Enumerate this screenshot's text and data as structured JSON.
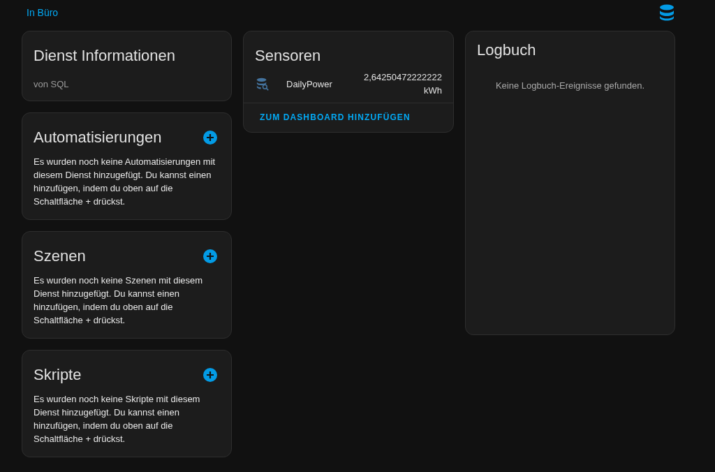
{
  "header": {
    "area_link": "In Büro"
  },
  "info_card": {
    "title": "Dienst Informationen",
    "subtitle": "von SQL"
  },
  "related_cards": [
    {
      "title": "Automatisierungen",
      "text": "Es wurden noch keine Automatisierungen mit diesem Dienst hinzugefügt. Du kannst einen hinzufügen, indem du oben auf die Schaltfläche + drückst."
    },
    {
      "title": "Szenen",
      "text": "Es wurden noch keine Szenen mit diesem Dienst hinzugefügt. Du kannst einen hinzufügen, indem du oben auf die Schaltfläche + drückst."
    },
    {
      "title": "Skripte",
      "text": "Es wurden noch keine Skripte mit diesem Dienst hinzugefügt. Du kannst einen hinzufügen, indem du oben auf die Schaltfläche + drückst."
    }
  ],
  "sensors_card": {
    "title": "Sensoren",
    "entities": [
      {
        "name": "DailyPower",
        "value": "2,64250472222222",
        "unit": "kWh"
      }
    ],
    "action": "ZUM DASHBOARD HINZUFÜGEN"
  },
  "logbook_card": {
    "title": "Logbuch",
    "empty_text": "Keine Logbuch-Ereignisse gefunden."
  }
}
